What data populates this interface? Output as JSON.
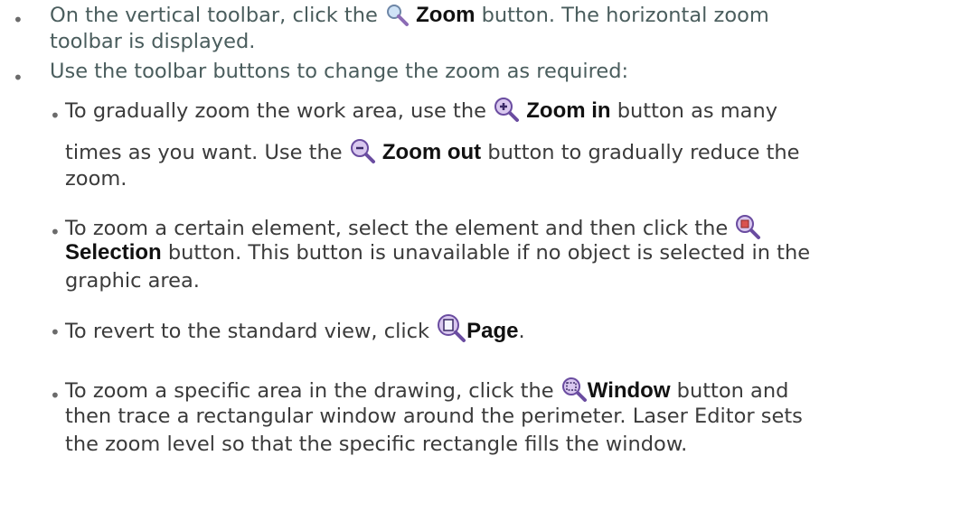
{
  "step1": {
    "pre": "On the vertical toolbar, click the",
    "bold": "Zoom",
    "post": "button. The horizontal zoom",
    "line2": "toolbar is displayed.",
    "icon": "magnifier-icon"
  },
  "step2": {
    "text": "Use the toolbar buttons to change the zoom as required:"
  },
  "sub1": {
    "pre": "To gradually zoom the work area, use the",
    "bold1": "Zoom in",
    "mid": "button as many",
    "l2_pre": "times as you want. Use the",
    "bold2": "Zoom out",
    "l2_post": "button to gradually reduce the",
    "line3": "zoom.",
    "icon1": "zoom-in-icon",
    "icon2": "zoom-out-icon"
  },
  "sub2": {
    "pre": "To zoom a certain element, select the element and then click the",
    "bold": "Selection",
    "post": "button. This button is unavailable if no object is selected in the",
    "line3": "graphic area.",
    "icon": "zoom-selection-icon"
  },
  "sub3": {
    "pre": "To revert to the standard view, click",
    "bold": "Page",
    "post": ".",
    "icon": "zoom-page-icon"
  },
  "sub4": {
    "pre": "To zoom a specific area in the drawing, click the",
    "bold": "Window",
    "post": "button and",
    "line2": "then trace a rectangular window around the perimeter. Laser Editor sets",
    "line3": "the zoom level so that the specific rectangle fills the window.",
    "icon": "zoom-window-icon"
  }
}
